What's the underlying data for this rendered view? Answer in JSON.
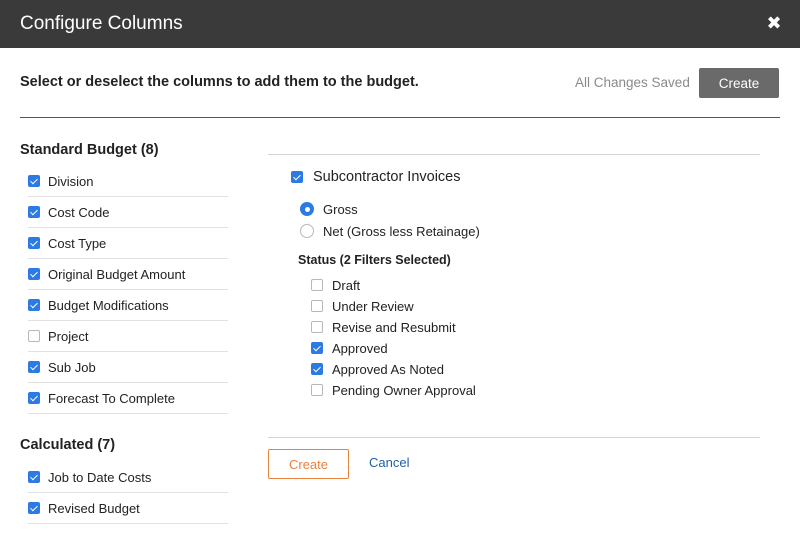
{
  "header": {
    "title": "Configure Columns",
    "close_glyph": "✖"
  },
  "toolbar": {
    "instruction": "Select or deselect the columns to add them to the budget.",
    "status": "All Changes Saved",
    "create_label": "Create"
  },
  "standard": {
    "title": "Standard Budget (8)",
    "items": [
      {
        "label": "Division",
        "checked": true
      },
      {
        "label": "Cost Code",
        "checked": true
      },
      {
        "label": "Cost Type",
        "checked": true
      },
      {
        "label": "Original Budget Amount",
        "checked": true
      },
      {
        "label": "Budget Modifications",
        "checked": true
      },
      {
        "label": "Project",
        "checked": false
      },
      {
        "label": "Sub Job",
        "checked": true
      },
      {
        "label": "Forecast To Complete",
        "checked": true
      }
    ]
  },
  "calculated": {
    "title": "Calculated (7)",
    "items": [
      {
        "label": "Job to Date Costs",
        "checked": true
      },
      {
        "label": "Revised Budget",
        "checked": true
      }
    ]
  },
  "detail": {
    "title": "Subcontractor Invoices",
    "checked": true,
    "options": [
      {
        "label": "Gross",
        "selected": true
      },
      {
        "label": "Net (Gross less Retainage)",
        "selected": false
      }
    ],
    "status_title": "Status (2 Filters Selected)",
    "statuses": [
      {
        "label": "Draft",
        "checked": false
      },
      {
        "label": "Under Review",
        "checked": false
      },
      {
        "label": "Revise and Resubmit",
        "checked": false
      },
      {
        "label": "Approved",
        "checked": true
      },
      {
        "label": "Approved As Noted",
        "checked": true
      },
      {
        "label": "Pending Owner Approval",
        "checked": false
      }
    ]
  },
  "footer": {
    "create_label": "Create",
    "cancel_label": "Cancel"
  }
}
